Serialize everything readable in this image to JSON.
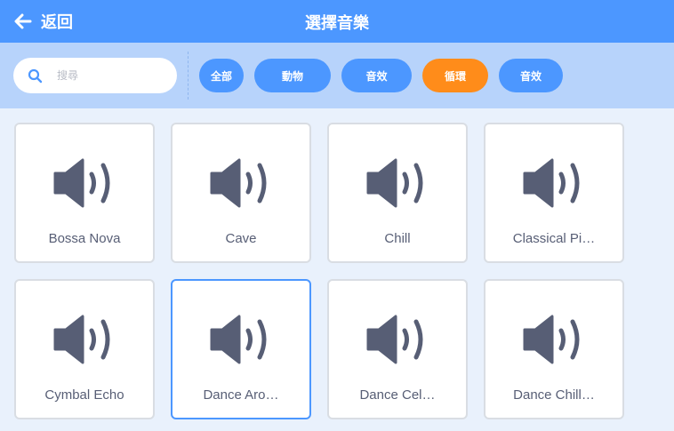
{
  "header": {
    "back_label": "返回",
    "title": "選擇音樂"
  },
  "search": {
    "placeholder": "搜尋"
  },
  "filters": [
    {
      "label": "全部",
      "active": false
    },
    {
      "label": "動物",
      "active": false
    },
    {
      "label": "音效",
      "active": false
    },
    {
      "label": "循環",
      "active": true
    },
    {
      "label": "音效",
      "active": false
    }
  ],
  "sounds": [
    {
      "name": "Bossa Nova",
      "selected": false
    },
    {
      "name": "Cave",
      "selected": false
    },
    {
      "name": "Chill",
      "selected": false
    },
    {
      "name": "Classical Pi…",
      "selected": false
    },
    {
      "name": "Cymbal Echo",
      "selected": false
    },
    {
      "name": "Dance Aro…",
      "selected": true
    },
    {
      "name": "Dance Cel…",
      "selected": false
    },
    {
      "name": "Dance Chill…",
      "selected": false
    }
  ],
  "colors": {
    "header": "#4c97ff",
    "filter_bar": "#b7d3fb",
    "chip": "#4c97ff",
    "chip_active": "#ff8c1a",
    "icon": "#575e75",
    "background": "#e9f1fc"
  }
}
